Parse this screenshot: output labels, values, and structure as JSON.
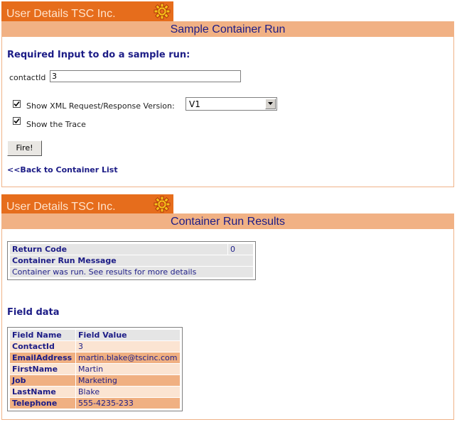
{
  "app": {
    "brand": "User Details TSC Inc."
  },
  "run_form": {
    "title": "Sample Container Run",
    "heading": "Required Input to do a sample run:",
    "contact_label": "contactId",
    "contact_value": "3",
    "show_xml_label": "Show XML Request/Response Version:",
    "show_xml_checked": true,
    "version_selected": "V1",
    "show_trace_label": "Show the Trace",
    "show_trace_checked": true,
    "fire_label": "Fire!",
    "back_link": "<<Back to Container List"
  },
  "results": {
    "title": "Container Run Results",
    "return_code_label": "Return Code",
    "return_code_value": "0",
    "message_label": "Container Run Message",
    "message_value": "Container was run. See results for more details",
    "field_data_heading": "Field data",
    "field_headers": [
      "Field Name",
      "Field Value"
    ],
    "fields": [
      {
        "name": "ContactId",
        "value": "3"
      },
      {
        "name": "EmailAddress",
        "value": "martin.blake@tscinc.com"
      },
      {
        "name": "FirstName",
        "value": "Martin"
      },
      {
        "name": "Job",
        "value": "Marketing"
      },
      {
        "name": "LastName",
        "value": "Blake"
      },
      {
        "name": "Telephone",
        "value": "555-4235-233"
      }
    ]
  },
  "icons": {
    "brand_icon": "gear-icon",
    "dropdown_icon": "chevron-down-icon",
    "checkbox_icon": "check-icon"
  },
  "colors": {
    "brand": "#e66d1c",
    "section_bar": "#f1b184",
    "heading_text": "#1c1c86",
    "row_light": "#fbe4d2",
    "row_dark": "#f0b082"
  }
}
